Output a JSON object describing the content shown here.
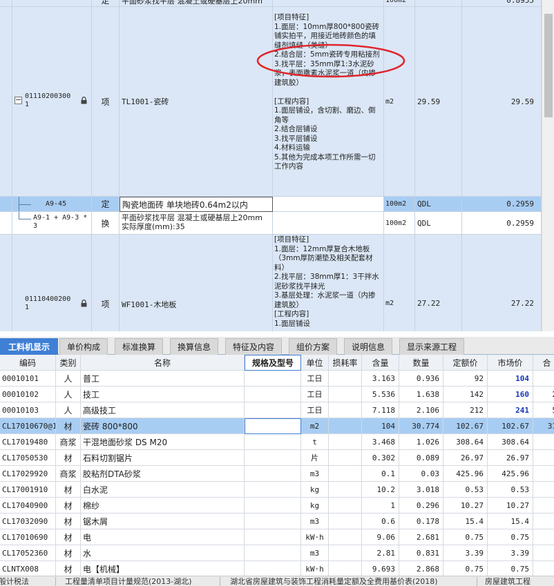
{
  "top_rows": [
    {
      "code": "",
      "type": "定",
      "name": "平面砂浆找平层 混凝土或硬基层上20mm",
      "features": "",
      "unit": "100m2",
      "qty": "",
      "total": "0.8955"
    },
    {
      "code": "011102003001",
      "locked": true,
      "type": "项",
      "name": "TL1001-瓷砖",
      "features": "[项目特征]\n1.面层：10mm厚800*800瓷砖铺实拍平，用接近地砖颜色的填缝剂填缝（美缝）\n2.结合层：5mm瓷砖专用粘接剂\n3.找平层：35mm厚1:3水泥砂浆，表面撒素水泥浆一道（内掺建筑胶）\n\n[工程内容]\n1.面层铺设，含切割、磨边、倒角等\n2.结合层铺设\n3.找平层铺设\n4.材料运输\n5.其他为完成本项工作所需一切工作内容",
      "unit": "m2",
      "qty": "29.59",
      "total": "29.59"
    },
    {
      "code": "A9-45",
      "type": "定",
      "name": "陶瓷地面砖 单块地砖0.64m2以内",
      "features": "",
      "unit": "100m2",
      "qty": "QDL",
      "total": "0.2959"
    },
    {
      "code": "A9-1 + A9-3 * 3",
      "type": "换",
      "name": "平面砂浆找平层 混凝土或硬基层上20mm 实际厚度(mm):35",
      "features": "",
      "unit": "100m2",
      "qty": "QDL",
      "total": "0.2959"
    },
    {
      "code": "011104002001",
      "locked": true,
      "type": "项",
      "name": "WF1001-木地板",
      "features": "[项目特征]\n1.面层：12mm厚复合木地板（3mm厚防潮垫及相关配套材料）\n2.找平层：38mm厚1：3干拌水泥砂浆找平抹光\n3.基层处理：水泥浆一道（内掺建筑胶）\n[工程内容]\n1.面层铺设",
      "unit": "m2",
      "qty": "27.22",
      "total": "27.22"
    }
  ],
  "tabs": [
    "工料机显示",
    "单价构成",
    "标准换算",
    "换算信息",
    "特征及内容",
    "组价方案",
    "说明信息",
    "显示来源工程"
  ],
  "grid_headers": [
    "编码",
    "类别",
    "名称",
    "规格及型号",
    "单位",
    "损耗率",
    "含量",
    "数量",
    "定额价",
    "市场价",
    "合"
  ],
  "grid_rows": [
    {
      "code": "00010101",
      "cat": "人",
      "name": "普工",
      "spec": "",
      "unit": "工日",
      "loss": "",
      "content": "3.163",
      "qty": "0.936",
      "price": "92",
      "market": "104",
      "extra": ""
    },
    {
      "code": "00010102",
      "cat": "人",
      "name": "技工",
      "spec": "",
      "unit": "工日",
      "loss": "",
      "content": "5.536",
      "qty": "1.638",
      "price": "142",
      "market": "160",
      "extra": "2"
    },
    {
      "code": "00010103",
      "cat": "人",
      "name": "高级技工",
      "spec": "",
      "unit": "工日",
      "loss": "",
      "content": "7.118",
      "qty": "2.106",
      "price": "212",
      "market": "241",
      "extra": "5"
    },
    {
      "code": "CL17010670@1",
      "cat": "材",
      "name": "瓷砖 800*800",
      "spec": "",
      "unit": "m2",
      "loss": "",
      "content": "104",
      "qty": "30.774",
      "price": "102.67",
      "market": "102.67",
      "extra": "31"
    },
    {
      "code": "CL17019480",
      "cat": "商浆",
      "name": "干混地面砂浆 DS M20",
      "spec": "",
      "unit": "t",
      "loss": "",
      "content": "3.468",
      "qty": "1.026",
      "price": "308.64",
      "market": "308.64",
      "extra": ""
    },
    {
      "code": "CL17050530",
      "cat": "材",
      "name": "石料切割锯片",
      "spec": "",
      "unit": "片",
      "loss": "",
      "content": "0.302",
      "qty": "0.089",
      "price": "26.97",
      "market": "26.97",
      "extra": ""
    },
    {
      "code": "CL17029920",
      "cat": "商浆",
      "name": "胶粘剂DTA砂浆",
      "spec": "",
      "unit": "m3",
      "loss": "",
      "content": "0.1",
      "qty": "0.03",
      "price": "425.96",
      "market": "425.96",
      "extra": ""
    },
    {
      "code": "CL17001910",
      "cat": "材",
      "name": "白水泥",
      "spec": "",
      "unit": "kg",
      "loss": "",
      "content": "10.2",
      "qty": "3.018",
      "price": "0.53",
      "market": "0.53",
      "extra": ""
    },
    {
      "code": "CL17040900",
      "cat": "材",
      "name": "棉纱",
      "spec": "",
      "unit": "kg",
      "loss": "",
      "content": "1",
      "qty": "0.296",
      "price": "10.27",
      "market": "10.27",
      "extra": ""
    },
    {
      "code": "CL17032090",
      "cat": "材",
      "name": "锯木屑",
      "spec": "",
      "unit": "m3",
      "loss": "",
      "content": "0.6",
      "qty": "0.178",
      "price": "15.4",
      "market": "15.4",
      "extra": ""
    },
    {
      "code": "CL17010690",
      "cat": "材",
      "name": "电",
      "spec": "",
      "unit": "kW·h",
      "loss": "",
      "content": "9.06",
      "qty": "2.681",
      "price": "0.75",
      "market": "0.75",
      "extra": ""
    },
    {
      "code": "CL17052360",
      "cat": "材",
      "name": "水",
      "spec": "",
      "unit": "m3",
      "loss": "",
      "content": "2.81",
      "qty": "0.831",
      "price": "3.39",
      "market": "3.39",
      "extra": ""
    },
    {
      "code": "CLNTX008",
      "cat": "材",
      "name": "电【机械】",
      "spec": "",
      "unit": "kW·h",
      "loss": "",
      "content": "9.693",
      "qty": "2.868",
      "price": "0.75",
      "market": "0.75",
      "extra": ""
    }
  ],
  "status": [
    "般计税法",
    "工程量清单项目计量规范(2013-湖北)",
    "湖北省房屋建筑与装饰工程消耗量定额及全费用基价表(2018)",
    "房屋建筑工程"
  ],
  "colors": {
    "accent": "#3f7fd6",
    "selected_row": "#a8cdf3",
    "item_row": "#dbe7f6",
    "annotation": "#e0262d",
    "market_price": "#1536b8"
  }
}
